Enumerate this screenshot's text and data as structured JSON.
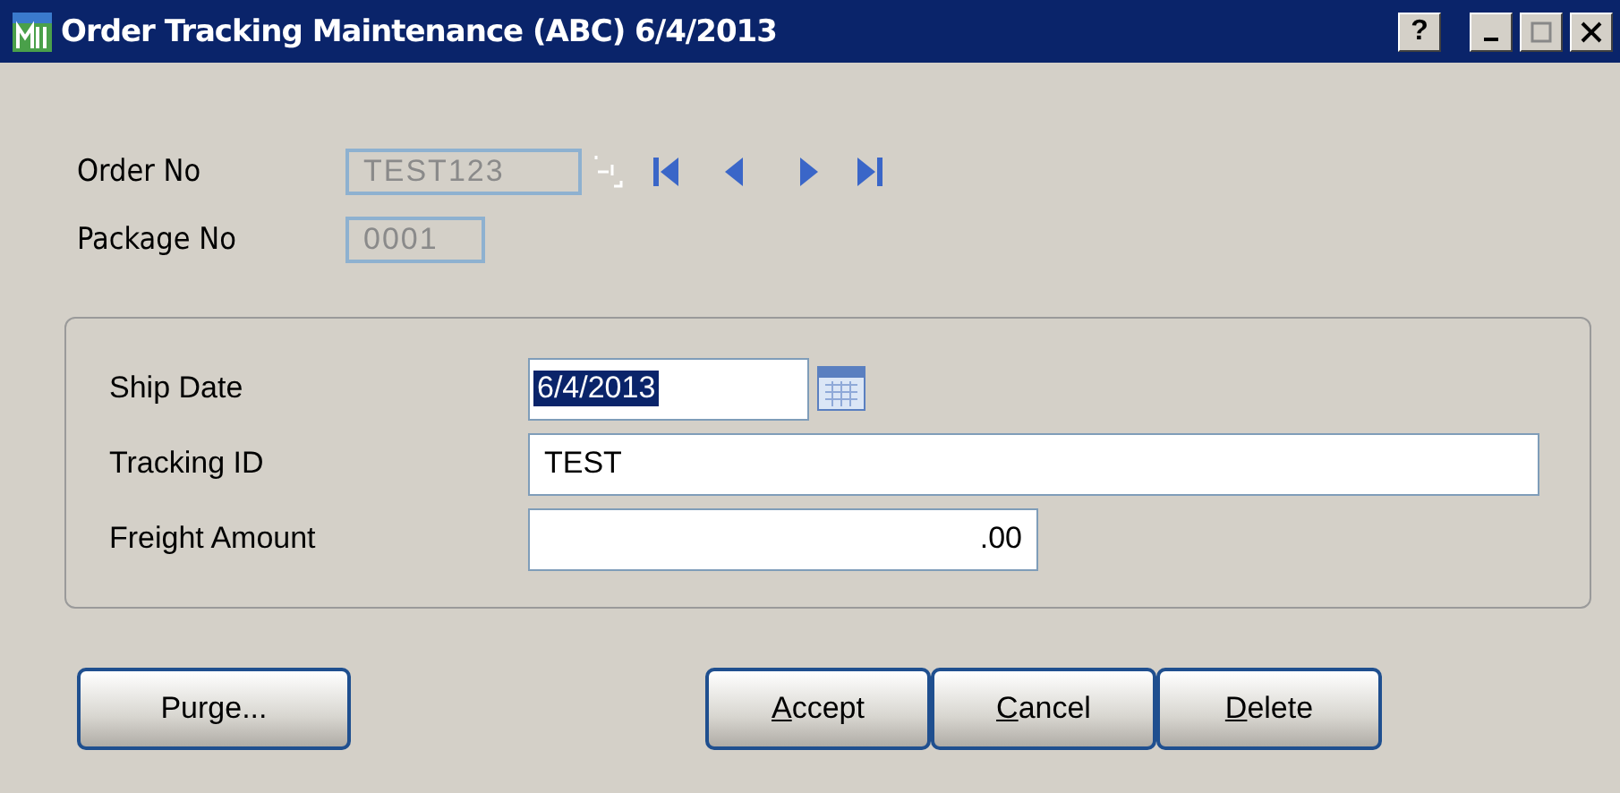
{
  "window": {
    "title": "Order Tracking Maintenance (ABC) 6/4/2013",
    "controls": [
      "?"
    ]
  },
  "header": {
    "fields": [
      {
        "label": "Order No",
        "value": "TEST123",
        "disabled": true,
        "kind": "nav"
      },
      {
        "label": "Package No",
        "value": "0001",
        "disabled": true,
        "kind": "short"
      }
    ]
  },
  "group": {
    "fields": [
      {
        "label": "Ship Date",
        "value": "6/4/2013",
        "selected": true,
        "kind": "date"
      },
      {
        "label": "Tracking ID",
        "value": "TEST",
        "selected": false,
        "kind": "wide"
      },
      {
        "label": "Freight Amount",
        "value": ".00",
        "selected": false,
        "kind": "amount"
      }
    ]
  },
  "buttons": [
    {
      "label": "Purge...",
      "underline_first": false,
      "kind": "left"
    },
    {
      "label": "Accept",
      "underline_first": true,
      "kind": "right"
    },
    {
      "label": "Cancel",
      "underline_first": true,
      "kind": "right"
    },
    {
      "label": "Delete",
      "underline_first": true,
      "kind": "right"
    }
  ]
}
